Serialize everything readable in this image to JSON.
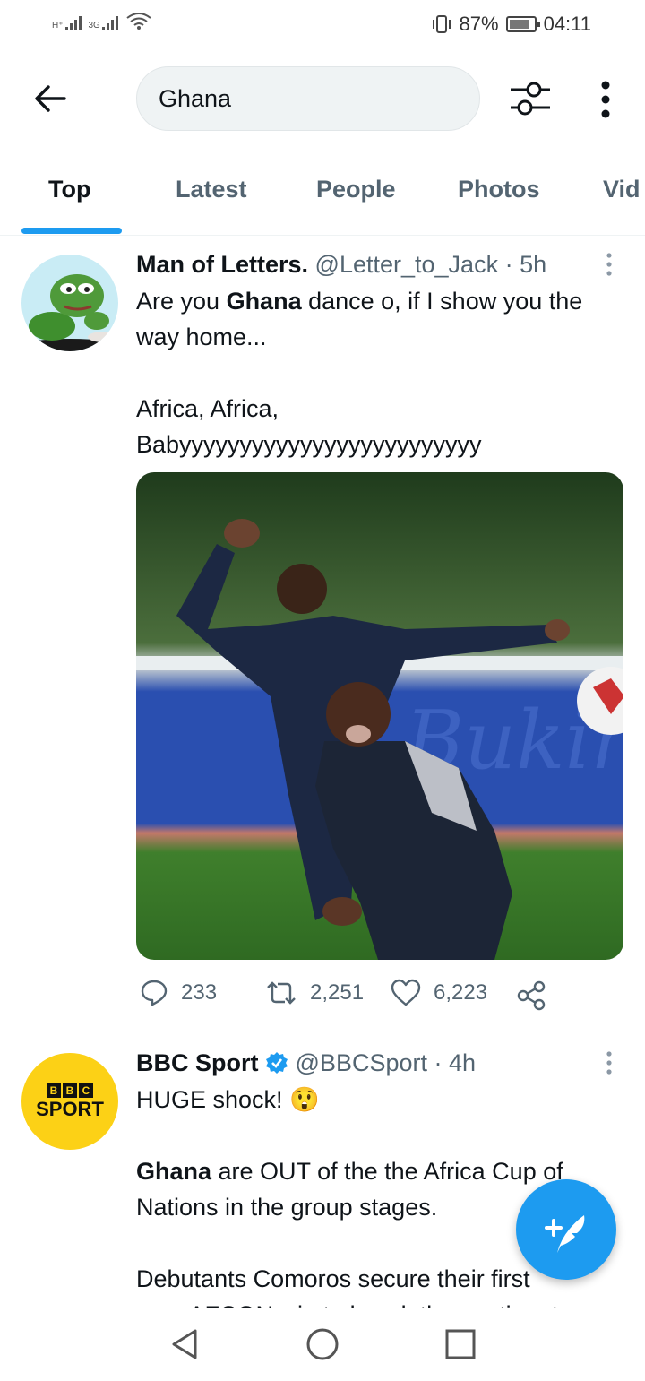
{
  "status_bar": {
    "network_1": "H⁺",
    "network_2": "3G",
    "battery_percent": "87%",
    "battery_level": 0.87,
    "time": "04:11"
  },
  "search": {
    "query": "Ghana"
  },
  "tabs": [
    {
      "label": "Top",
      "active": true
    },
    {
      "label": "Latest",
      "active": false
    },
    {
      "label": "People",
      "active": false
    },
    {
      "label": "Photos",
      "active": false
    },
    {
      "label": "Vid",
      "active": false
    }
  ],
  "tweets": [
    {
      "author_name": "Man of Letters.",
      "handle": "@Letter_to_Jack",
      "time": "· 5h",
      "text_pre": "Are you ",
      "text_bold": "Ghana",
      "text_post": " dance o, if I show you the way home...\n\nAfrica, Africa, Babyyyyyyyyyyyyyyyyyyyyyyyyy",
      "replies": "233",
      "retweets": "2,251",
      "likes": "6,223"
    },
    {
      "author_name": "BBC Sport",
      "handle": "@BBCSport",
      "time": "· 4h",
      "verified": true,
      "line1": "HUGE shock! 😲",
      "text_bold": "Ghana",
      "text_post": " are OUT of the the Africa Cup of Nations in the group stages.",
      "line3": "Debutants Comoros secure their first",
      "line4": "ever AFCON win to knock the continent",
      "avatar_logo_top": "BBC",
      "avatar_logo_bottom": "SPORT"
    }
  ],
  "colors": {
    "accent": "#1d9bf0",
    "secondary_text": "#536471",
    "bbc_yellow": "#fcd116"
  }
}
